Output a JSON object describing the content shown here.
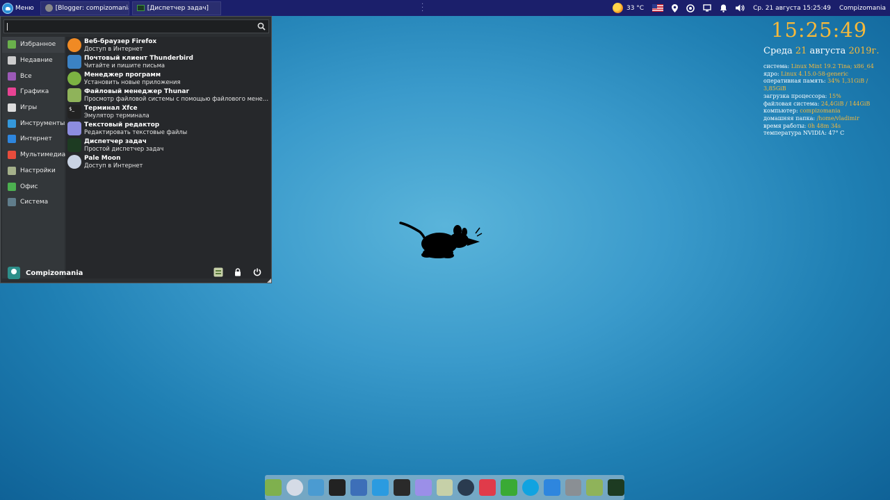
{
  "top_panel": {
    "menu_label": "Меню",
    "tasks": [
      {
        "label": "[Blogger: compizomania ..."
      },
      {
        "label": "[Диспетчер задач]"
      }
    ],
    "weather": "33 °C",
    "datetime": "Ср. 21 августа 15:25:49",
    "user": "Compizomania"
  },
  "menu": {
    "search_value": "",
    "categories": [
      {
        "label": "Избранное",
        "icon": "folder-green-icon",
        "color": "#6ab04c"
      },
      {
        "label": "Недавние",
        "icon": "clock-icon",
        "color": "#cccccc"
      },
      {
        "label": "Все",
        "icon": "grid-icon",
        "color": "#9b59b6"
      },
      {
        "label": "Графика",
        "icon": "palette-icon",
        "color": "#e84393"
      },
      {
        "label": "Игры",
        "icon": "gamepad-icon",
        "color": "#dddddd"
      },
      {
        "label": "Инструменты",
        "icon": "tools-icon",
        "color": "#3498db"
      },
      {
        "label": "Интернет",
        "icon": "globe-icon",
        "color": "#2e86de"
      },
      {
        "label": "Мультимедиа",
        "icon": "play-icon",
        "color": "#e74c3c"
      },
      {
        "label": "Настройки",
        "icon": "settings-icon",
        "color": "#a4b08a"
      },
      {
        "label": "Офис",
        "icon": "office-icon",
        "color": "#4caf50"
      },
      {
        "label": "Система",
        "icon": "gear-icon",
        "color": "#607d8b"
      }
    ],
    "apps": [
      {
        "name": "Веб-браузер Firefox",
        "desc": "Доступ в Интернет",
        "icon": "firefox-icon",
        "color": "#f08a24"
      },
      {
        "name": "Почтовый клиент Thunderbird",
        "desc": "Читайте и пишите письма",
        "icon": "mail-icon",
        "color": "#3b82c4"
      },
      {
        "name": "Менеджер программ",
        "desc": "Установить новые приложения",
        "icon": "software-manager-icon",
        "color": "#7cb342"
      },
      {
        "name": "Файловый менеджер Thunar",
        "desc": "Просмотр файловой системы с помощью файлового менеджера",
        "icon": "folder-icon",
        "color": "#8fb35a"
      },
      {
        "name": "Терминал Xfce",
        "desc": "Эмулятор терминала",
        "icon": "terminal-icon",
        "color": "#222222"
      },
      {
        "name": "Текстовый редактор",
        "desc": "Редактировать текстовые файлы",
        "icon": "text-editor-icon",
        "color": "#8d8de0"
      },
      {
        "name": "Диспетчер задач",
        "desc": "Простой диспетчер задач",
        "icon": "task-manager-icon",
        "color": "#1d3b22"
      },
      {
        "name": "Pale Moon",
        "desc": "Доступ в Интернет",
        "icon": "palemoon-icon",
        "color": "#c9d3e3"
      }
    ],
    "user_name": "Compizomania"
  },
  "conky": {
    "time": "15:25:49",
    "date_day": "Среда",
    "date_num": "21",
    "date_month": "августа",
    "date_year": "2019г.",
    "rows": [
      {
        "label": "система:",
        "value": "Linux Mint 19.2 Tina; x86_64"
      },
      {
        "label": "ядро:",
        "value": "Linux 4.15.0-58-generic"
      },
      {
        "label": "оперативная память:",
        "value": "34% 1,31GiB / 3,85GiB"
      },
      {
        "label": "загрузка процессора:",
        "value": "15%"
      },
      {
        "label": "файловая система:",
        "value": "24,4GiB / 144GiB"
      },
      {
        "label": "компьютер:",
        "value": "compizomania"
      },
      {
        "label": "домашняя папка:",
        "value": "/home/vladimir"
      },
      {
        "label": "время работы:",
        "value": "0h 48m 34s"
      },
      {
        "label": "температура NVIDIA:",
        "value": "47° C"
      }
    ]
  },
  "dock": {
    "items": [
      {
        "icon": "home-folder-icon",
        "color": "#7fb04e"
      },
      {
        "icon": "palemoon-icon",
        "color": "#d5dbe6"
      },
      {
        "icon": "tv-icon",
        "color": "#4b9bd1"
      },
      {
        "icon": "terminal-icon",
        "color": "#222222"
      },
      {
        "icon": "screenshot-icon",
        "color": "#3d6fb8"
      },
      {
        "icon": "compiz-icon",
        "color": "#2b9be0"
      },
      {
        "icon": "imagemagick-icon",
        "color": "#2a2a2a"
      },
      {
        "icon": "text-editor-icon",
        "color": "#9b8fe8"
      },
      {
        "icon": "settings-icon",
        "color": "#c6d0a8"
      },
      {
        "icon": "steam-icon",
        "color": "#2a3b4f"
      },
      {
        "icon": "pocket-icon",
        "color": "#e03b4a"
      },
      {
        "icon": "shield-icon",
        "color": "#3aaa35"
      },
      {
        "icon": "skype-icon",
        "color": "#11a3e0"
      },
      {
        "icon": "weather-icon",
        "color": "#2e86de"
      },
      {
        "icon": "trash-icon",
        "color": "#8a8f94"
      },
      {
        "icon": "folder-icon",
        "color": "#8fb35a"
      },
      {
        "icon": "system-monitor-icon",
        "color": "#1d3b22"
      }
    ]
  }
}
